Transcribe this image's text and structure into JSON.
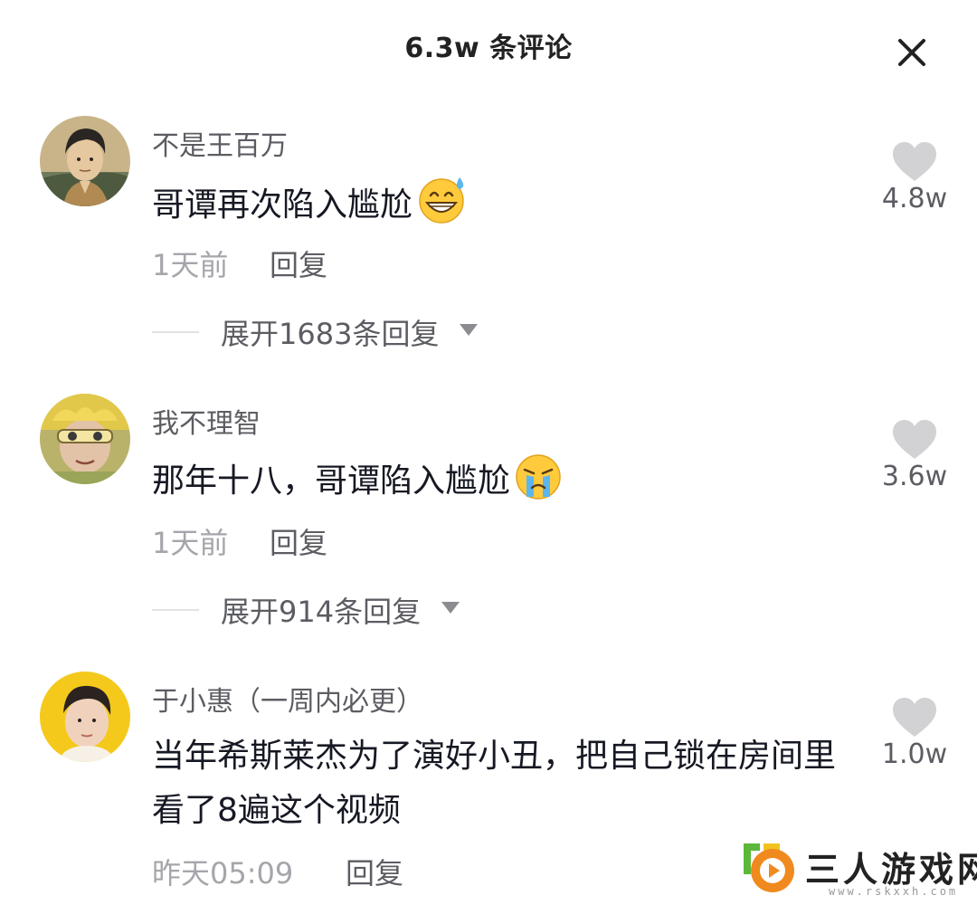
{
  "header": {
    "title": "6.3w 条评论",
    "close_icon": "close-icon"
  },
  "comments": [
    {
      "username": "不是王百万",
      "text": "哥谭再次陷入尴尬",
      "emoji": "grinning-sweat-emoji",
      "time": "1天前",
      "reply_label": "回复",
      "expand_label": "展开1683条回复",
      "likes": "4.8w"
    },
    {
      "username": "我不理智",
      "text": "那年十八，哥谭陷入尴尬",
      "emoji": "crying-emoji",
      "time": "1天前",
      "reply_label": "回复",
      "expand_label": "展开914条回复",
      "likes": "3.6w"
    },
    {
      "username": "于小惠（一周内必更）",
      "text": "当年希斯莱杰为了演好小丑，把自己锁在房间里看了8遍这个视频",
      "time": "昨天05:09",
      "reply_label": "回复",
      "likes": "1.0w"
    }
  ],
  "watermark": {
    "title": "三人游戏网",
    "url": "www.rskxxh.com"
  },
  "colors": {
    "text_primary": "#161823",
    "text_secondary": "#5c5d63",
    "text_muted": "#a5a6ab",
    "heart": "#d2d2d4",
    "background": "#ffffff"
  }
}
